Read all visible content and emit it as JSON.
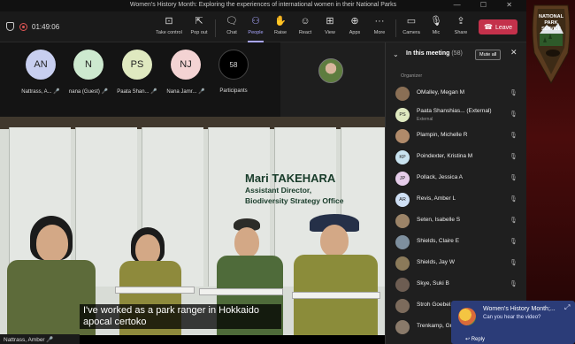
{
  "window": {
    "title": "Women's History Month: Exploring the experiences of international women in their National Parks",
    "controls": "— ☐ ✕"
  },
  "toolbar": {
    "timer": "01:49:06",
    "buttons": [
      {
        "label": "Take control",
        "icon": "hand-screen-icon",
        "glyph": "⊡"
      },
      {
        "label": "Pop out",
        "icon": "popout-icon",
        "glyph": "⇱"
      },
      {
        "label": "Chat",
        "icon": "chat-icon",
        "glyph": "💬"
      },
      {
        "label": "People",
        "icon": "people-icon",
        "glyph": "👥"
      },
      {
        "label": "Raise",
        "icon": "raise-hand-icon",
        "glyph": "✋"
      },
      {
        "label": "React",
        "icon": "react-icon",
        "glyph": "☺"
      },
      {
        "label": "View",
        "icon": "view-icon",
        "glyph": "⊞"
      },
      {
        "label": "Apps",
        "icon": "apps-icon",
        "glyph": "⊕"
      },
      {
        "label": "More",
        "icon": "more-icon",
        "glyph": "···"
      },
      {
        "label": "Camera",
        "icon": "camera-icon",
        "glyph": "📷"
      },
      {
        "label": "Mic",
        "icon": "mic-icon",
        "glyph": "🎙"
      },
      {
        "label": "Share",
        "icon": "share-icon",
        "glyph": "⇪"
      }
    ],
    "leave_label": "Leave"
  },
  "strip": {
    "participants": [
      {
        "initials": "AN",
        "name": "Nattrass, A...",
        "color": "#c8cff0"
      },
      {
        "initials": "N",
        "name": "nana (Guest)",
        "color": "#cde9cf"
      },
      {
        "initials": "PS",
        "name": "Paata Shan...",
        "color": "#dfe9c0"
      },
      {
        "initials": "NJ",
        "name": "Nana Jamr...",
        "color": "#f3d3d3"
      }
    ],
    "more_count": "58",
    "more_label": "Participants"
  },
  "video": {
    "name": "Mari TAKEHARA",
    "role_line1": "Assistant Director,",
    "role_line2": "Biodiversity Strategy Office",
    "caption_line1": "I've worked as a park ranger in Hokkaido",
    "caption_line2": "apocal certoko",
    "presenter": "Nattrass, Amber"
  },
  "people_panel": {
    "title": "In this meeting",
    "count": "(58)",
    "mute_all": "Mute all",
    "organizer_label": "Organizer",
    "rows": [
      {
        "initials": "",
        "name": "OMalley, Megan M",
        "sub": "",
        "color": "#8a6f55"
      },
      {
        "initials": "PS",
        "name": "Paata Shanshias... (External)",
        "sub": "External",
        "color": "#dfe9c0"
      },
      {
        "initials": "",
        "name": "Plampin, Michelle R",
        "sub": "",
        "color": "#b08a6a"
      },
      {
        "initials": "KP",
        "name": "Poindexter, Kristina M",
        "sub": "",
        "color": "#c9e3f0"
      },
      {
        "initials": "JP",
        "name": "Pollack, Jessica A",
        "sub": "",
        "color": "#e6cdea"
      },
      {
        "initials": "AR",
        "name": "Revis, Amber L",
        "sub": "",
        "color": "#cfe0f5"
      },
      {
        "initials": "",
        "name": "Seten, Isabelle S",
        "sub": "",
        "color": "#9c8468"
      },
      {
        "initials": "",
        "name": "Shields, Claire E",
        "sub": "",
        "color": "#7e8f9e"
      },
      {
        "initials": "",
        "name": "Shields, Jay W",
        "sub": "",
        "color": "#8b7a5a"
      },
      {
        "initials": "",
        "name": "Skye, Suki B",
        "sub": "",
        "color": "#6d5d52"
      },
      {
        "initials": "",
        "name": "Stroh Goebel...",
        "sub": "",
        "color": "#7c6b5c"
      },
      {
        "initials": "",
        "name": "Trenkamp, Gr...",
        "sub": "",
        "color": "#8a7a6a"
      }
    ]
  },
  "toast": {
    "title": "Women's History Month;...",
    "message": "Can you hear the video?",
    "reply": "Reply"
  },
  "logo": {
    "line1": "NATIONAL",
    "line2": "PARK",
    "line3": "SERVICE"
  }
}
